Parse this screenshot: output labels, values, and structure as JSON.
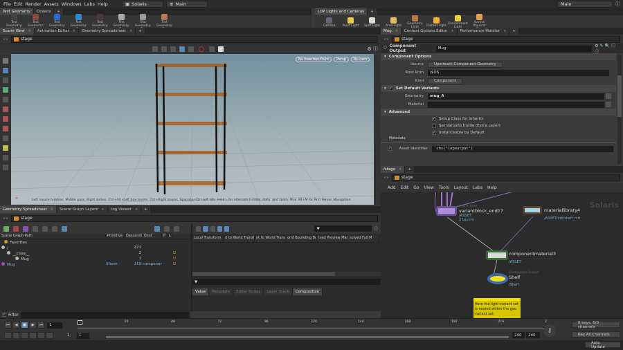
{
  "menu": {
    "items": [
      "File",
      "Edit",
      "Render",
      "Assets",
      "Windows",
      "Labs",
      "Help"
    ],
    "desktop": "Solaris",
    "context": "Main",
    "right_context": "Main"
  },
  "shelf_left": {
    "tabs": [
      "Test Geometry",
      "Oceans"
    ],
    "tools": [
      "Test Geometry: C...",
      "Test Geometry: P...",
      "Test Geometry: R...",
      "Test Geometry: S...",
      "Test Geometry: S...",
      "Test Geometry: T...",
      "Test Geometry: T...",
      "Test Geometry: T..."
    ]
  },
  "shelf_right": {
    "tabs": [
      "LOP Lights and Cameras"
    ],
    "tools": [
      "Camera",
      "Point Light",
      "Spot Light",
      "Area Light",
      "Geometry Light",
      "Distant Light",
      "Environment Light",
      "Karma Physical Sky..."
    ]
  },
  "viewer": {
    "tabs": [
      "Scene View",
      "Animation Editor",
      "Geometry Spreadsheet"
    ],
    "path": "stage",
    "menus": [
      "No Insertion Point",
      "Persp",
      "No cam"
    ],
    "hint": "Left mouse tumbles. Middle pans. Right dollies. Ctrl+Alt+Left box-zooms. Ctrl+Right zooms. Spacebar-Ctrl-Left tilts. Hold L for alternate tumble, dolly, and zoom. M or Alt+M for First Person Navigation."
  },
  "params": {
    "tabs": [
      "Mug",
      "Context Options Editor",
      "Performance Monitor"
    ],
    "path": "stage",
    "node_type": "Component Output",
    "node_name": "Mug",
    "section1": "Component Options",
    "source_label": "Source",
    "source_value": "Upstream Component Geometry",
    "rootprim_label": "Root Prim",
    "rootprim_value": "/$OS",
    "kind_label": "Kind",
    "kind_value": "Component",
    "section2": "Set Default Variants",
    "geometry_label": "Geometry",
    "geometry_value": "mug_A",
    "material_label": "Material",
    "material_value": "",
    "section3": "Advanced",
    "check1": "Setup Class for Inherits",
    "check2": "Set Variants Inside (Extra Layer)",
    "check3": "Instanceable by Default",
    "metadata": "Metadata",
    "asset_id_label": "Asset Identifier",
    "asset_id_value": "`chs(\"lopoutput\")`"
  },
  "network": {
    "tabs": [
      "/stage"
    ],
    "path": "stage",
    "menus": [
      "Add",
      "Edit",
      "Go",
      "View",
      "Tools",
      "Layout",
      "Labs",
      "Help"
    ],
    "watermark": "Solaris",
    "nodes": [
      {
        "type": "Add Variant",
        "name": "variantblock_end17",
        "sub1": "/ASSET",
        "sub2": "2 Layers"
      },
      {
        "type": "",
        "name": "materiallibrary4",
        "sub1": "/ASSET/mtl/shelf_mtl",
        "sub2": ""
      },
      {
        "type": "",
        "name": "componentmaterial3",
        "sub1": "/ASSET",
        "sub2": ""
      },
      {
        "type": "Component Output",
        "name": "Shelf",
        "sub1": "/Shelf",
        "sub2": ""
      }
    ],
    "sticky": "Here the light variant set is nested within the geo variant set."
  },
  "scenegraph": {
    "tabs": [
      "Geometry Spreadsheet",
      "Scene Graph Layers",
      "Log Viewer"
    ],
    "path": "stage",
    "columns": [
      "Scene Graph Path",
      "Primitive",
      "Descenda",
      "Kind",
      "P",
      "L"
    ],
    "rows": [
      {
        "path": "Favorites",
        "prim": "",
        "desc": "",
        "kind": ""
      },
      {
        "path": "/",
        "prim": "",
        "desc": "221",
        "kind": ""
      },
      {
        "path": "__class__",
        "prim": "",
        "desc": "2",
        "kind": ""
      },
      {
        "path": "Mug",
        "prim": "",
        "desc": "1",
        "kind": ""
      },
      {
        "path": "Mug",
        "prim": "Xform",
        "desc": "219",
        "kind": "component"
      }
    ],
    "filter_label": "Filter"
  },
  "details": {
    "columns": [
      "Local Transform",
      "d to World Transf",
      "nt to World Trans",
      "orld Bounding Bo",
      "lved Preview Mat",
      "solved Full M"
    ],
    "tabs": [
      "Value",
      "Metadata",
      "Editor Nodes",
      "Layer Stack",
      "Composition"
    ]
  },
  "timeline": {
    "frame": "1",
    "ticks": [
      "1",
      "24",
      "48",
      "72",
      "96",
      "120",
      "144",
      "168",
      "192",
      "216",
      "2"
    ],
    "start": "1",
    "start2": "1",
    "end": "240",
    "end2": "240",
    "keys": "0 keys, 0/0 channels",
    "key_all": "Key All Channels",
    "update": "Auto Update"
  }
}
